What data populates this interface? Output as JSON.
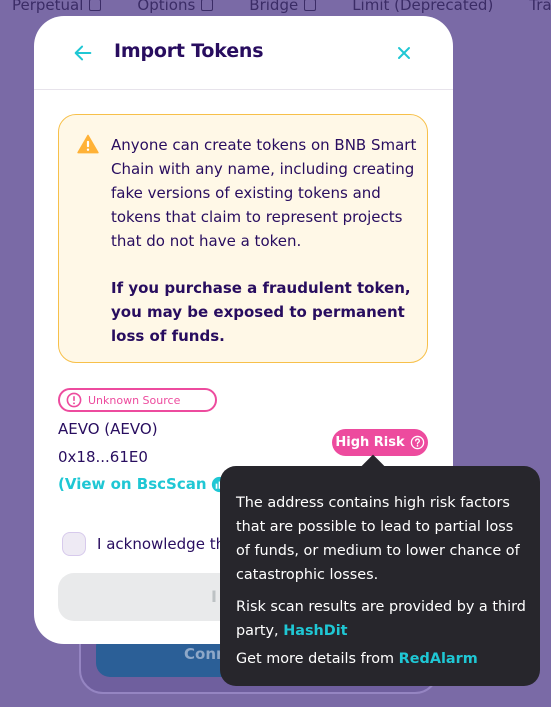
{
  "background": {
    "nav_items": [
      "Perpetual",
      "Options",
      "Bridge",
      "Limit (Deprecated)",
      "Trading"
    ],
    "connect_label": "Conn"
  },
  "modal": {
    "title": "Import Tokens",
    "warning": {
      "body": "Anyone can create tokens on BNB Smart Chain with any name, including creating fake versions of existing tokens and tokens that claim to represent projects that do not have a token.",
      "strong": "If you purchase a fraudulent token, you may be exposed to permanent loss of funds."
    },
    "source_badge": "Unknown Source",
    "token_name": "AEVO  (AEVO)",
    "token_address": "0x18...61E0",
    "view_link": "(View on BscScan",
    "view_link_suffix": ")",
    "risk_label": "High Risk",
    "acknowledge": "I acknowledge the",
    "import_button": "I"
  },
  "tooltip": {
    "main": "The address contains high risk factors that are possible to lead to partial loss of funds, or medium to lower chance of catastrophic losses.",
    "provider_prefix": "Risk scan results are provided by a third party,",
    "provider_link": "HashDit",
    "details_prefix": "Get more details from",
    "details_link": "RedAlarm"
  },
  "colors": {
    "primary_text": "#280d5f",
    "accent": "#1fc7d4",
    "danger": "#ed4b9e",
    "warning_bg": "#fff8e7",
    "warning_border": "#f7c04a",
    "tooltip_bg": "#27262c"
  },
  "icons": [
    "arrow-left-icon",
    "close-icon",
    "warning-icon",
    "alert-circle-icon",
    "bscscan-icon",
    "help-icon",
    "external-link-icon"
  ]
}
